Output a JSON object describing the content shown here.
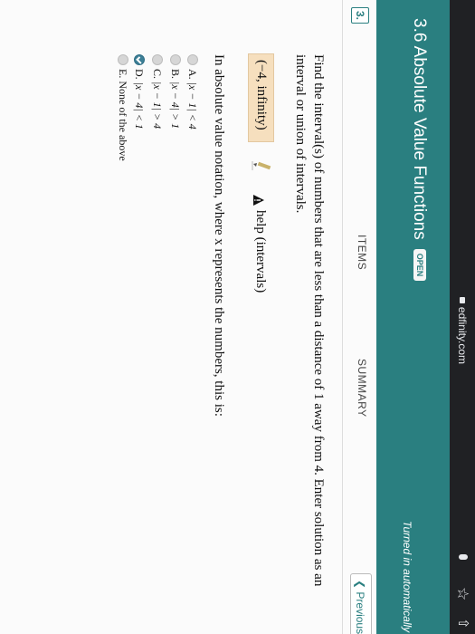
{
  "browser": {
    "url": "edfinity.com"
  },
  "header": {
    "title": "3.6 Absolute Value Functions",
    "badge": "OPEN",
    "status": "Turned in automatically w"
  },
  "nav": {
    "question_number": "3.",
    "tab_items": "ITEMS",
    "tab_summary": "SUMMARY",
    "previous": "Previous"
  },
  "question": {
    "line1": "Find the interval(s) of numbers that are less than a distance of 1 away from 4. Enter solution as an",
    "line2": "interval or union of intervals.",
    "answer_value": "(−4, infinity)",
    "help_text": "help (intervals)",
    "line3": "In absolute value notation, where x represents the numbers, this is:",
    "choices": [
      {
        "letter": "A.",
        "text": "|x − 1| < 4",
        "selected": false
      },
      {
        "letter": "B.",
        "text": "|x − 4| > 1",
        "selected": false
      },
      {
        "letter": "C.",
        "text": "|x − 1| > 4",
        "selected": false
      },
      {
        "letter": "D.",
        "text": "|x − 4| < 1",
        "selected": true
      },
      {
        "letter": "E.",
        "text": "None of the above",
        "selected": false
      }
    ]
  },
  "colors": {
    "header": "#2a7f80",
    "answer_bg": "#f6dfbe",
    "selected_radio": "#3c7f96"
  }
}
